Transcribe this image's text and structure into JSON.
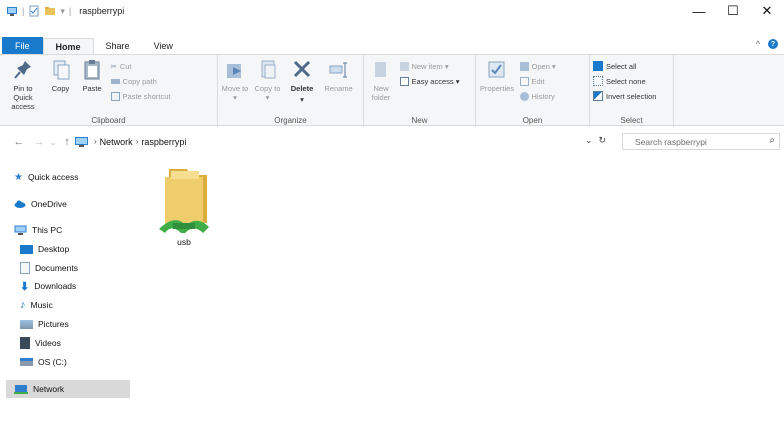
{
  "window": {
    "title": "raspberrypi",
    "controls": {
      "minimize": "—",
      "maximize": "☐",
      "close": "✕"
    }
  },
  "tabs": [
    {
      "label": "File"
    },
    {
      "label": "Home"
    },
    {
      "label": "Share"
    },
    {
      "label": "View"
    }
  ],
  "ribbon": {
    "clipboard": {
      "label": "Clipboard",
      "pin": "Pin to Quick access",
      "copy": "Copy",
      "paste": "Paste",
      "cut": "Cut",
      "copy_path": "Copy path",
      "paste_shortcut": "Paste shortcut"
    },
    "organize": {
      "label": "Organize",
      "move_to": "Move to ▾",
      "copy_to": "Copy to ▾",
      "delete": "Delete",
      "rename": "Rename"
    },
    "new": {
      "label": "New",
      "new_folder": "New folder",
      "new_item": "New item ▾",
      "easy_access": "Easy access ▾"
    },
    "open": {
      "label": "Open",
      "properties": "Properties",
      "open": "Open ▾",
      "edit": "Edit",
      "history": "History"
    },
    "select": {
      "label": "Select",
      "select_all": "Select all",
      "select_none": "Select none",
      "invert": "Invert selection"
    }
  },
  "address": {
    "crumbs": [
      "Network",
      "raspberrypi"
    ],
    "dropdown": "⌄",
    "refresh": "↻"
  },
  "search": {
    "placeholder": "Search raspberrypi"
  },
  "nav": {
    "quick_access": "Quick access",
    "onedrive": "OneDrive",
    "this_pc": "This PC",
    "desktop": "Desktop",
    "documents": "Documents",
    "downloads": "Downloads",
    "music": "Music",
    "pictures": "Pictures",
    "videos": "Videos",
    "os": "OS (C:)",
    "network": "Network"
  },
  "files": [
    {
      "name": "usb"
    }
  ],
  "colors": {
    "accent": "#1979ca",
    "folder": "#e8c35a",
    "share": "#3fae49",
    "selected": "#d9d9d9"
  }
}
